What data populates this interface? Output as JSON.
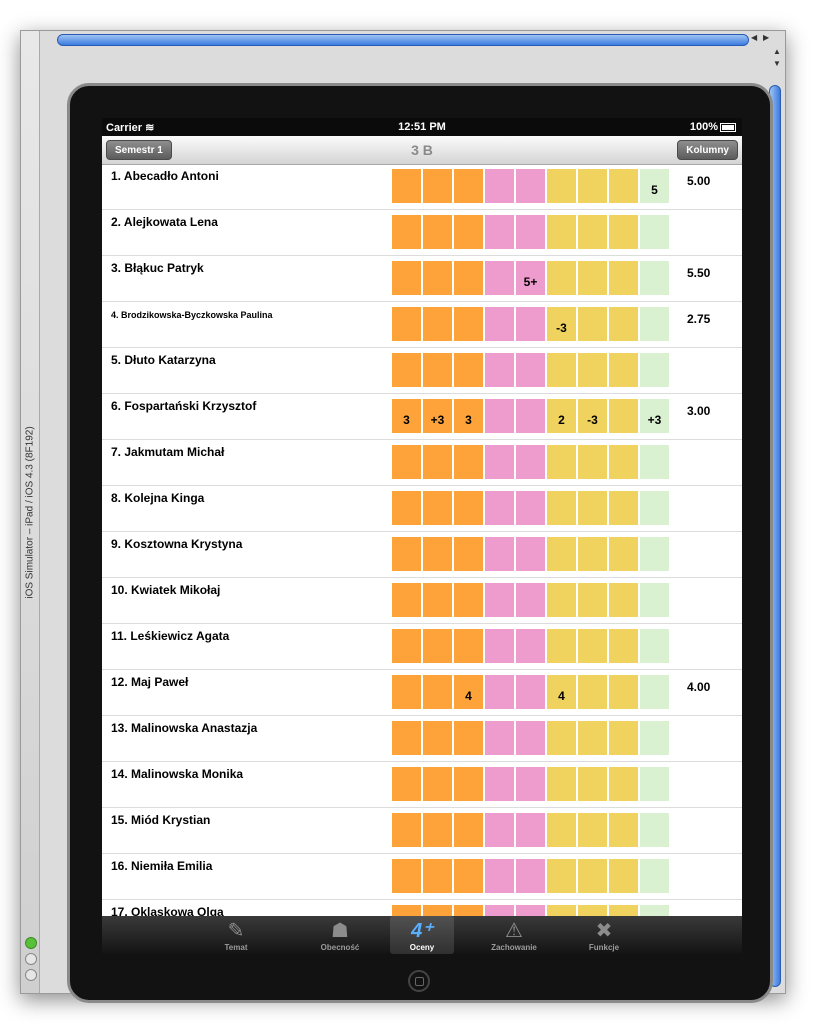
{
  "simulator": {
    "label": "iOS Simulator – iPad / iOS 4.3 (8F192)"
  },
  "status_bar": {
    "carrier": "Carrier",
    "time": "12:51 PM",
    "battery": "100%"
  },
  "nav": {
    "left_button": "Semestr 1",
    "title": "3 B",
    "right_button": "Kolumny"
  },
  "colors": {
    "orange": "#fda33a",
    "pink": "#ee9ccd",
    "yellow": "#f0d35e",
    "green": "#d9f1d1"
  },
  "grade_columns": [
    "orange",
    "orange",
    "orange",
    "pink",
    "pink",
    "yellow",
    "yellow",
    "yellow",
    "green"
  ],
  "students": [
    {
      "name": "1. Abecadło Antoni",
      "grades": [
        "",
        "",
        "",
        "",
        "",
        "",
        "",
        "",
        "5"
      ],
      "avg": "5.00"
    },
    {
      "name": "2. Alejkowata Lena",
      "grades": [
        "",
        "",
        "",
        "",
        "",
        "",
        "",
        "",
        ""
      ],
      "avg": ""
    },
    {
      "name": "3. Błąkuc Patryk",
      "grades": [
        "",
        "",
        "",
        "",
        "5+",
        "",
        "",
        "",
        ""
      ],
      "avg": "5.50"
    },
    {
      "name": "4. Brodzikowska-Byczkowska Paulina",
      "grades": [
        "",
        "",
        "",
        "",
        "",
        "-3",
        "",
        "",
        ""
      ],
      "avg": "2.75",
      "small": true
    },
    {
      "name": "5. Dłuto Katarzyna",
      "grades": [
        "",
        "",
        "",
        "",
        "",
        "",
        "",
        "",
        ""
      ],
      "avg": ""
    },
    {
      "name": "6. Fospartański Krzysztof",
      "grades": [
        "3",
        "+3",
        "3",
        "",
        "",
        "2",
        "-3",
        "",
        "+3"
      ],
      "avg": "3.00"
    },
    {
      "name": "7. Jakmutam Michał",
      "grades": [
        "",
        "",
        "",
        "",
        "",
        "",
        "",
        "",
        ""
      ],
      "avg": ""
    },
    {
      "name": "8. Kolejna Kinga",
      "grades": [
        "",
        "",
        "",
        "",
        "",
        "",
        "",
        "",
        ""
      ],
      "avg": ""
    },
    {
      "name": "9. Kosztowna Krystyna",
      "grades": [
        "",
        "",
        "",
        "",
        "",
        "",
        "",
        "",
        ""
      ],
      "avg": ""
    },
    {
      "name": "10. Kwiatek Mikołaj",
      "grades": [
        "",
        "",
        "",
        "",
        "",
        "",
        "",
        "",
        ""
      ],
      "avg": ""
    },
    {
      "name": "11. Leśkiewicz Agata",
      "grades": [
        "",
        "",
        "",
        "",
        "",
        "",
        "",
        "",
        ""
      ],
      "avg": ""
    },
    {
      "name": "12. Maj Paweł",
      "grades": [
        "",
        "",
        "4",
        "",
        "",
        "4",
        "",
        "",
        ""
      ],
      "avg": "4.00"
    },
    {
      "name": "13. Malinowska Anastazja",
      "grades": [
        "",
        "",
        "",
        "",
        "",
        "",
        "",
        "",
        ""
      ],
      "avg": ""
    },
    {
      "name": "14. Malinowska Monika",
      "grades": [
        "",
        "",
        "",
        "",
        "",
        "",
        "",
        "",
        ""
      ],
      "avg": ""
    },
    {
      "name": "15. Miód Krystian",
      "grades": [
        "",
        "",
        "",
        "",
        "",
        "",
        "",
        "",
        ""
      ],
      "avg": ""
    },
    {
      "name": "16. Niemiła Emilia",
      "grades": [
        "",
        "",
        "",
        "",
        "",
        "",
        "",
        "",
        ""
      ],
      "avg": ""
    },
    {
      "name": "17. Oklaskowa  Olga",
      "grades": [
        "",
        "",
        "",
        "",
        "",
        "",
        "",
        "",
        ""
      ],
      "avg": ""
    }
  ],
  "tabs": [
    {
      "id": "temat",
      "label": "Temat",
      "icon": "pen-icon",
      "glyph": "✎",
      "active": false
    },
    {
      "id": "obecnosc",
      "label": "Obecność",
      "icon": "elephant-icon",
      "glyph": "☗",
      "active": false
    },
    {
      "id": "oceny",
      "label": "Oceny",
      "icon": "grade-4plus-icon",
      "glyph": "4⁺",
      "active": true
    },
    {
      "id": "zachowanie",
      "label": "Zachowanie",
      "icon": "warning-icon",
      "glyph": "⚠",
      "active": false
    },
    {
      "id": "funkcje",
      "label": "Funkcje",
      "icon": "tools-icon",
      "glyph": "✖",
      "active": false
    }
  ]
}
